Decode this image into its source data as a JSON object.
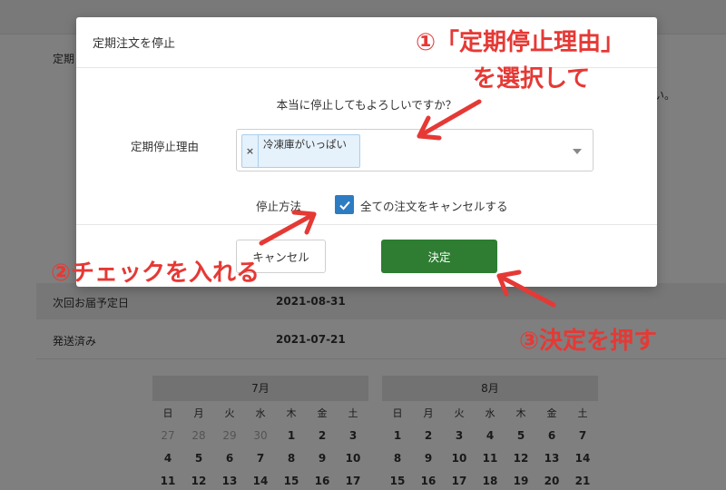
{
  "background": {
    "partial_label": "定期",
    "partial_tail": "い。",
    "rows": [
      {
        "label": "次回お届予定日",
        "value": "2021-08-31"
      },
      {
        "label": "発送済み",
        "value": "2021-07-21"
      }
    ],
    "calendars": [
      {
        "month": "7月",
        "weekdays": [
          "日",
          "月",
          "火",
          "水",
          "木",
          "金",
          "土"
        ],
        "weeks": [
          [
            "27",
            "28",
            "29",
            "30",
            "1",
            "2",
            "3"
          ],
          [
            "4",
            "5",
            "6",
            "7",
            "8",
            "9",
            "10"
          ],
          [
            "11",
            "12",
            "13",
            "14",
            "15",
            "16",
            "17"
          ]
        ]
      },
      {
        "month": "8月",
        "weekdays": [
          "日",
          "月",
          "火",
          "水",
          "木",
          "金",
          "土"
        ],
        "weeks": [
          [
            "1",
            "2",
            "3",
            "4",
            "5",
            "6",
            "7"
          ],
          [
            "8",
            "9",
            "10",
            "11",
            "12",
            "13",
            "14"
          ],
          [
            "15",
            "16",
            "17",
            "18",
            "19",
            "20",
            "21"
          ]
        ]
      }
    ]
  },
  "modal": {
    "title": "定期注文を停止",
    "message": "本当に停止してもよろしいですか？",
    "reason_label": "定期停止理由",
    "reason_tag_remove": "×",
    "reason_tag": "冷凍庫がいっぱい",
    "method_label": "停止方法",
    "method_checkbox_label": "全ての注文をキャンセルする",
    "method_checked": true,
    "cancel_label": "キャンセル",
    "confirm_label": "決定"
  },
  "annotations": {
    "step1_line1": "①「定期停止理由」",
    "step1_line2": "を選択して",
    "step2": "②チェックを入れる",
    "step3": "③決定を押す"
  },
  "colors": {
    "annotation": "#e53935",
    "confirm_button": "#2e7d32",
    "checkbox": "#2d7cc2",
    "tag_bg": "#e5f1fb"
  }
}
